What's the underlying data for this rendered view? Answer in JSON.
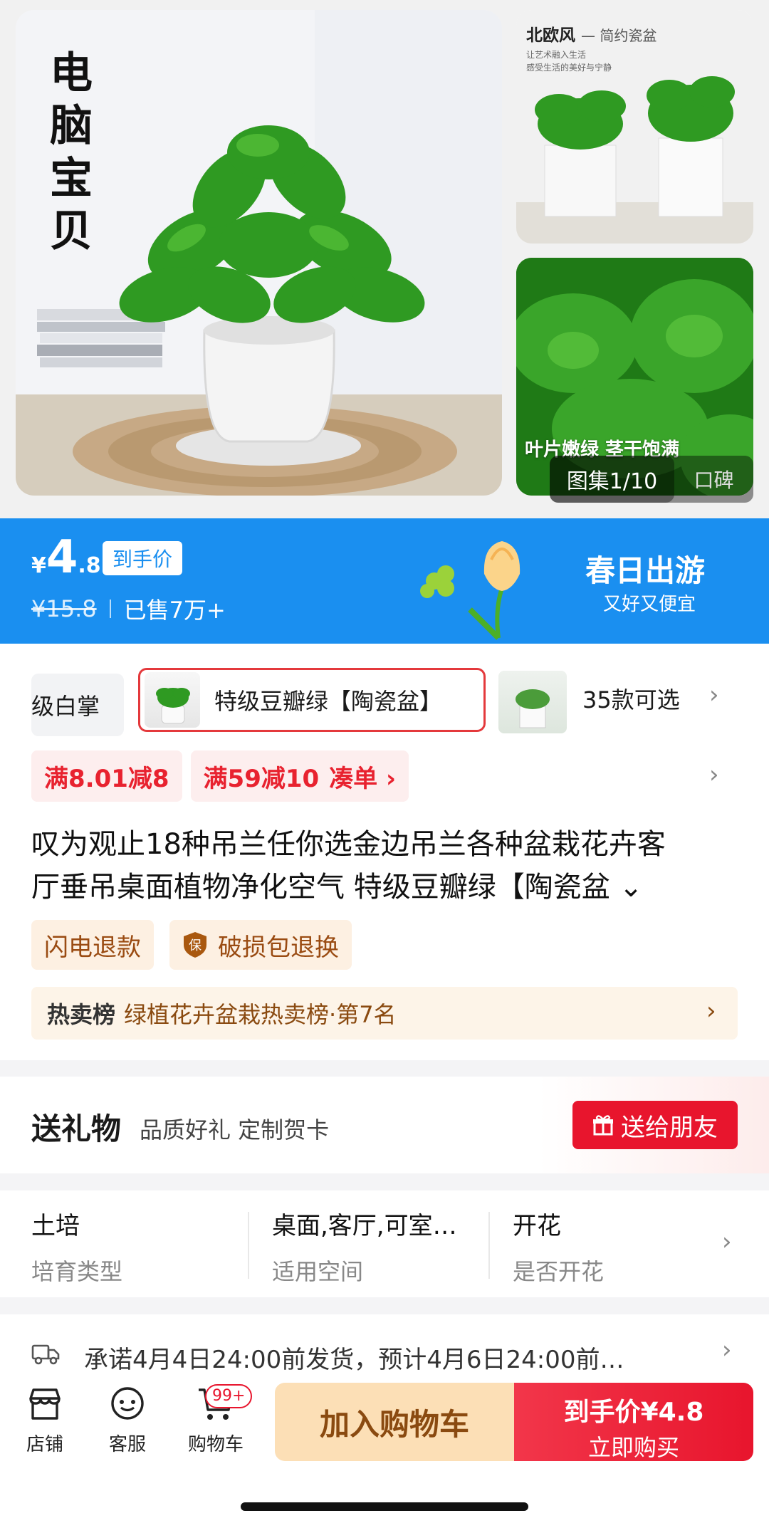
{
  "gallery": {
    "main_caption": "电脑宝贝",
    "side_top_title": "北欧风",
    "side_top_title_suffix": "— 简约瓷盆",
    "side_top_sub1": "让艺术融入生活",
    "side_top_sub2": "感受生活的美好与宁静",
    "side_bottom_overlay": "叶片嫩绿 茎干饱满",
    "counter": "图集1/10",
    "reviews_tab": "口碑"
  },
  "price": {
    "currency": "¥",
    "integer": "4",
    "decimal": ".8",
    "tag": "到手价",
    "original": "¥15.8",
    "sold": "已售7万+",
    "promo_title": "春日出游",
    "promo_sub": "又好又便宜"
  },
  "variants": {
    "prev_label": "级白掌",
    "selected_label": "特级豆瓣绿【陶瓷盆】",
    "count_label": "35款可选",
    "chevron": "›"
  },
  "coupons": {
    "c1": "满8.01减8",
    "c2": "满59减10",
    "c2_link": "凑单 ›",
    "chevron": "›"
  },
  "product": {
    "title_line1": "叹为观止18种吊兰任你选金边吊兰各种盆栽花卉客",
    "title_line2": "厅垂吊桌面植物净化空气 特级豆瓣绿【陶瓷盆 ⌄"
  },
  "services": {
    "s1": "闪电退款",
    "s2_icon_text": "保",
    "s2": "破损包退换"
  },
  "ranking": {
    "key": "热卖榜",
    "text": "绿植花卉盆栽热卖榜·第7名",
    "chevron": "›"
  },
  "gift": {
    "title": "送礼物",
    "sub": "品质好礼 定制贺卡",
    "button": "送给朋友"
  },
  "attributes": [
    {
      "value": "土培",
      "key": "培育类型"
    },
    {
      "value": "桌面,客厅,可室…",
      "key": "适用空间"
    },
    {
      "value": "开花",
      "key": "是否开花"
    }
  ],
  "attributes_chevron": "›",
  "shipping": {
    "text": "承诺4月4日24:00前发货，预计4月6日24:00前…",
    "chevron": "›"
  },
  "bottom_bar": {
    "store": "店铺",
    "service": "客服",
    "cart": "购物车",
    "cart_badge": "99+",
    "add_to_cart": "加入购物车",
    "buy_line1": "到手价¥4.8",
    "buy_line2": "立即购买"
  },
  "colors": {
    "brand_blue": "#1a8ff0",
    "accent_red": "#e8152d",
    "cart_button": "#fcdfb6"
  }
}
